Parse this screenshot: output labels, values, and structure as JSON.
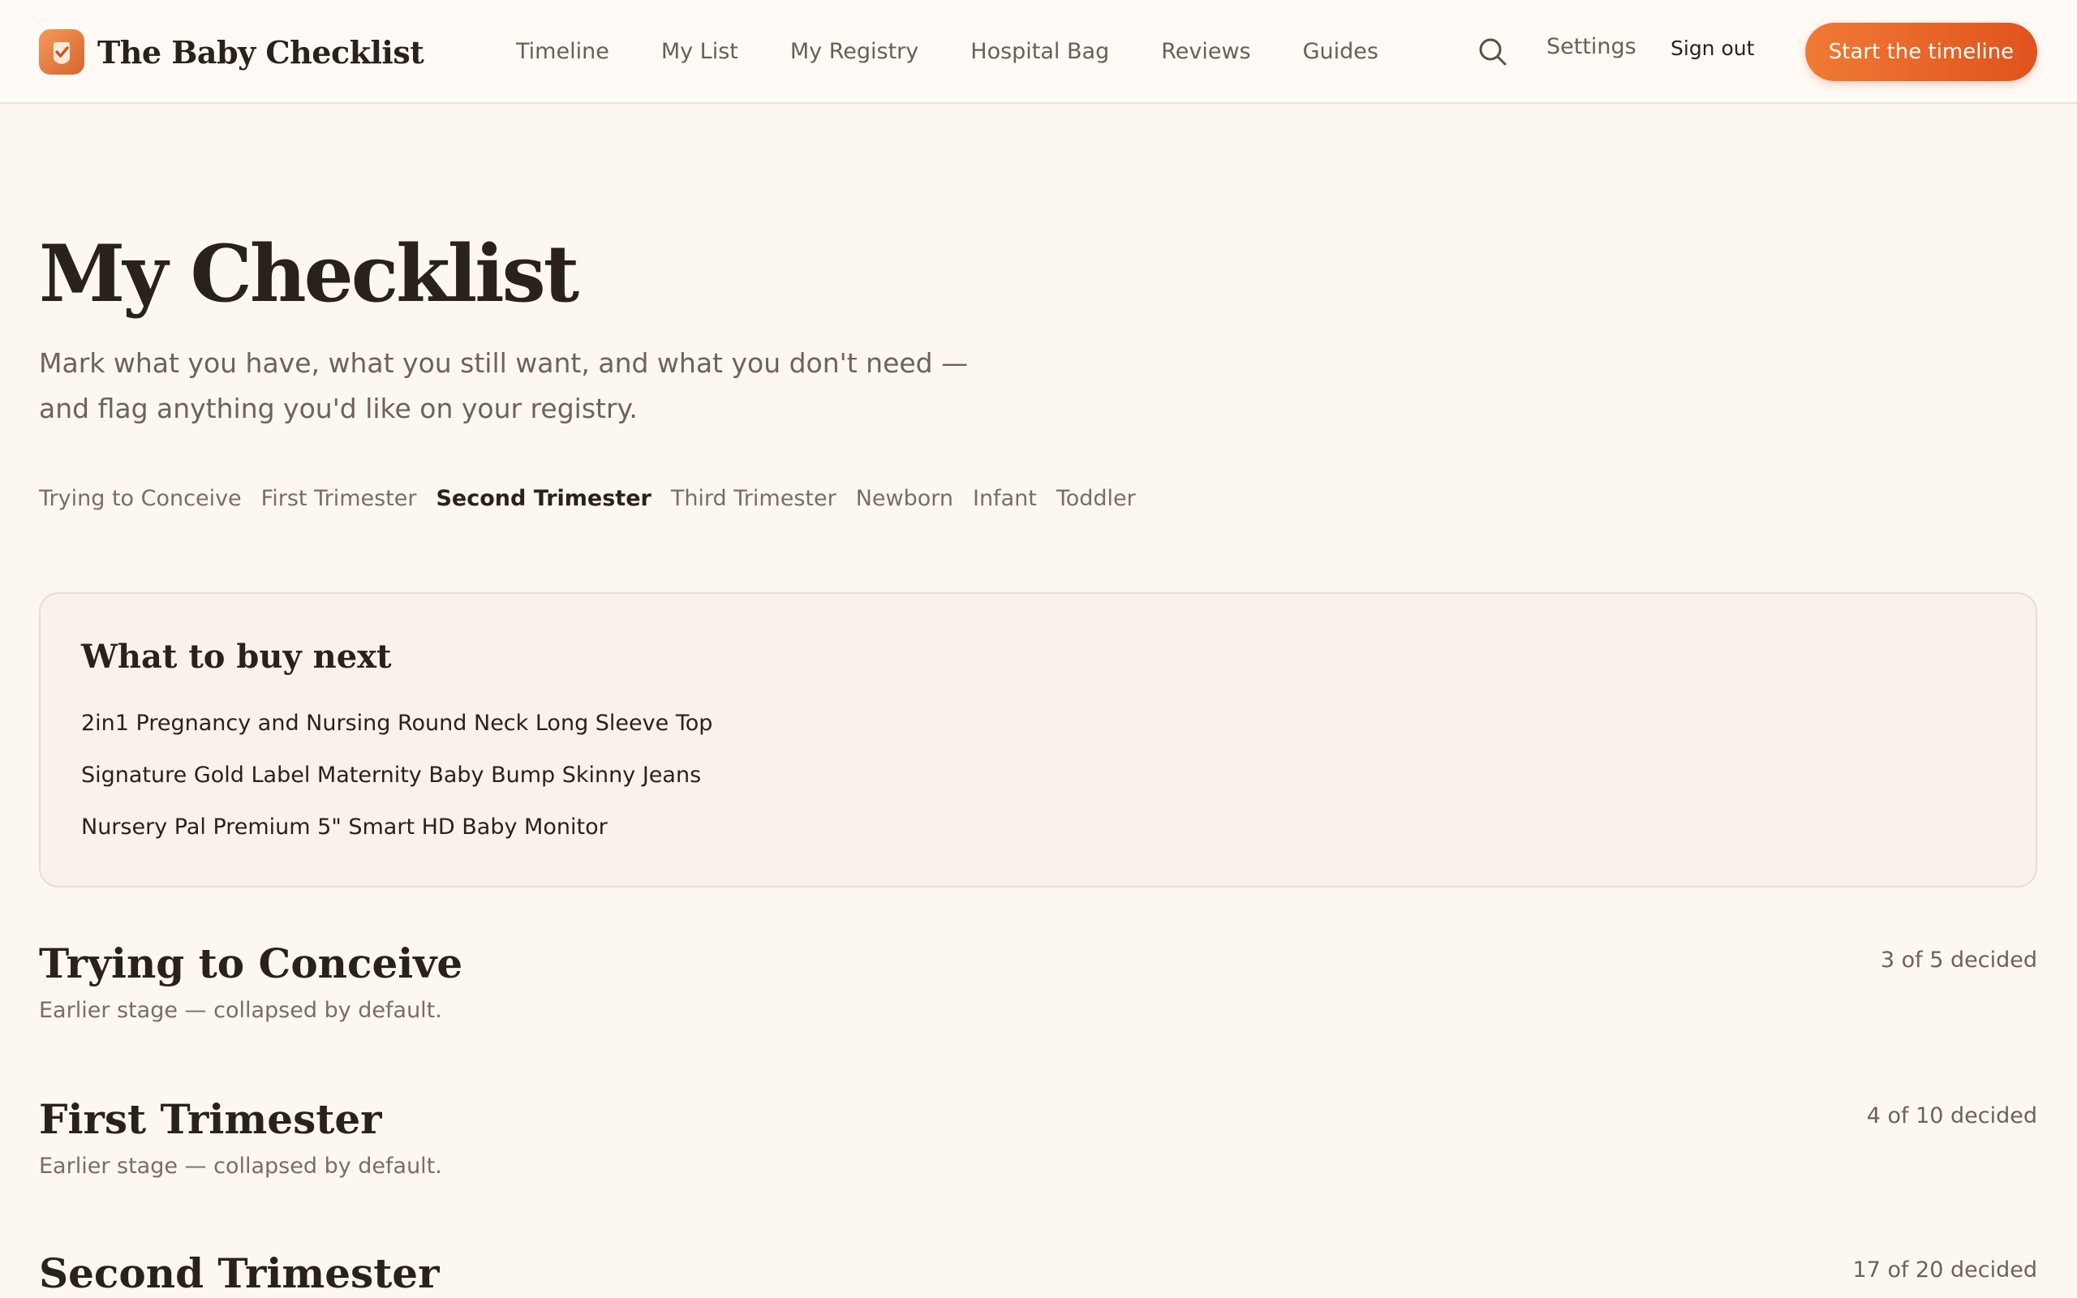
{
  "brand": {
    "name": "The Baby Checklist",
    "accent": "#e0521e"
  },
  "nav": {
    "items": [
      "Timeline",
      "My List",
      "My Registry",
      "Hospital Bag",
      "Reviews",
      "Guides"
    ],
    "settings": "Settings",
    "sign_out": "Sign out",
    "cta": "Start the timeline",
    "search_icon": "search-icon"
  },
  "page": {
    "title": "My Checklist",
    "subtitle_line1": "Mark what you have, what you still want, and what you don't need —",
    "subtitle_line2": "and flag anything you'd like on your registry."
  },
  "stage_tabs": {
    "items": [
      "Trying to Conceive",
      "First Trimester",
      "Second Trimester",
      "Third Trimester",
      "Newborn",
      "Infant",
      "Toddler"
    ],
    "active": "Second Trimester"
  },
  "buy_next": {
    "title": "What to buy next",
    "items": [
      "2in1 Pregnancy and Nursing Round Neck Long Sleeve Top",
      "Signature Gold Label Maternity Baby Bump Skinny Jeans",
      "Nursery Pal Premium 5\" Smart HD Baby Monitor"
    ]
  },
  "sections": [
    {
      "title": "Trying to Conceive",
      "note": "Earlier stage — collapsed by default.",
      "count": "3 of 5 decided"
    },
    {
      "title": "First Trimester",
      "note": "Earlier stage — collapsed by default.",
      "count": "4 of 10 decided"
    },
    {
      "title": "Second Trimester",
      "note": "",
      "count": "17 of 20 decided"
    }
  ]
}
